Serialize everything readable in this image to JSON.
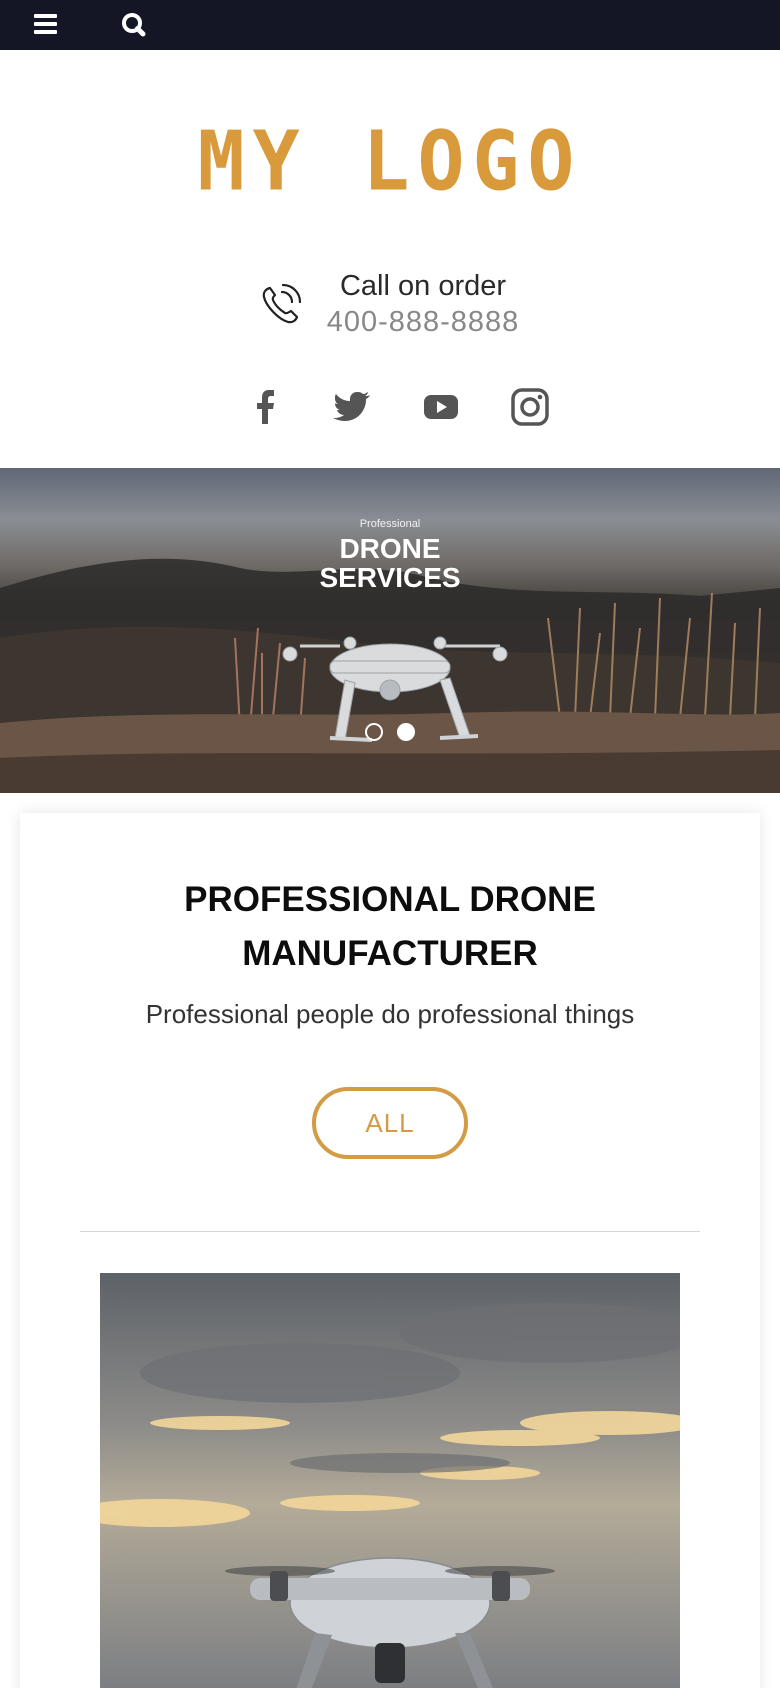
{
  "topbar": {
    "menu_icon": "hamburger-menu-icon",
    "search_icon": "search-icon",
    "background": "#141625"
  },
  "logo": {
    "text": "MY LOGO",
    "color": "#d89a3a"
  },
  "contact": {
    "icon": "phone-icon",
    "label": "Call on order",
    "number": "400-888-8888"
  },
  "social": {
    "items": [
      {
        "icon": "facebook-icon"
      },
      {
        "icon": "twitter-icon"
      },
      {
        "icon": "youtube-icon"
      },
      {
        "icon": "instagram-icon"
      }
    ]
  },
  "hero": {
    "kicker": "Professional",
    "title_line1": "DRONE",
    "title_line2": "SERVICES",
    "slides": 2,
    "active_slide": 2
  },
  "intro": {
    "title_line1": "PROFESSIONAL DRONE",
    "title_line2": "MANUFACTURER",
    "subtitle": "Professional people do professional things",
    "button_label": "ALL",
    "accent": "#d39b43"
  }
}
